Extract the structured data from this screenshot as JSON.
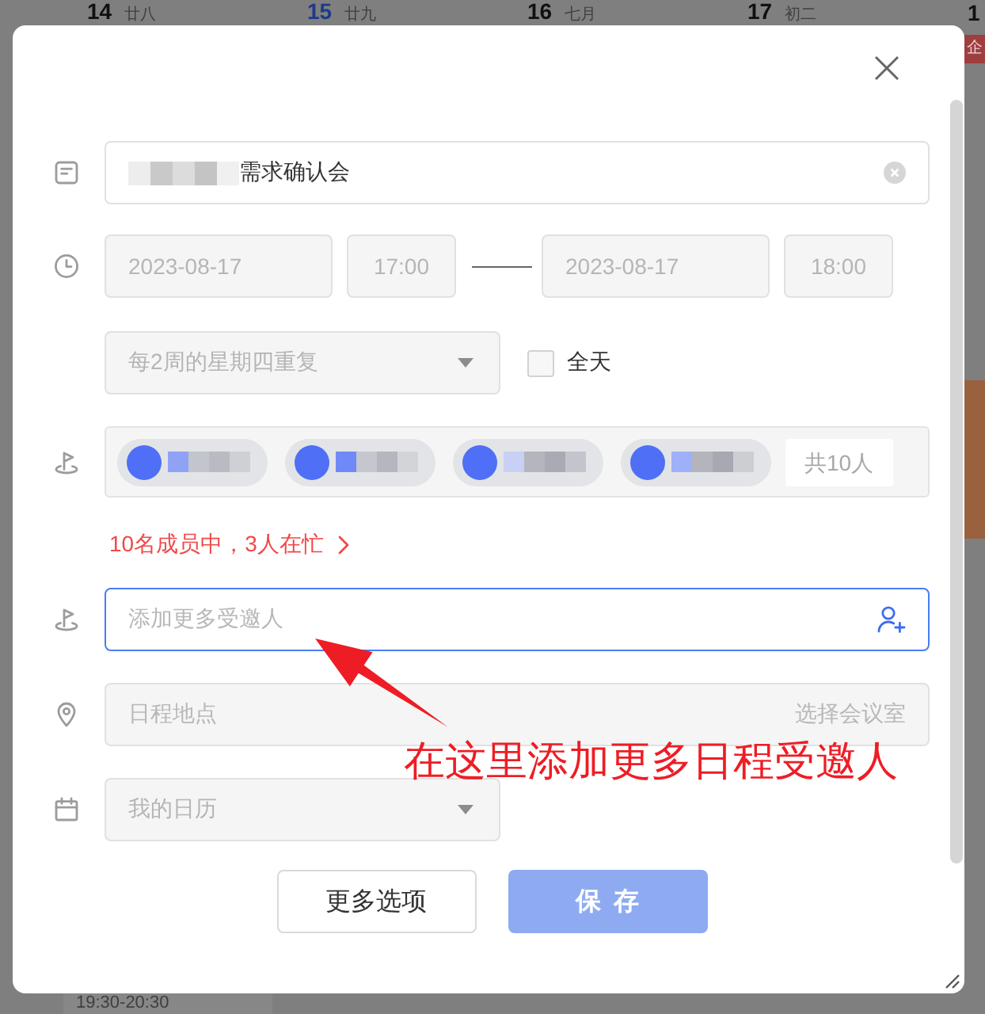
{
  "calendar": {
    "days": [
      {
        "date": "14",
        "lunar": "廿八",
        "today": false
      },
      {
        "date": "15",
        "lunar": "廿九",
        "today": true
      },
      {
        "date": "16",
        "lunar": "七月",
        "today": false
      },
      {
        "date": "17",
        "lunar": "初二",
        "today": false
      },
      {
        "date": "1",
        "today": false
      }
    ],
    "tag": "企",
    "event_time": "19:30-20:30"
  },
  "dialog": {
    "title_field": {
      "value": "需求确认会",
      "redacted_prefix": true
    },
    "time": {
      "disabled": true,
      "start_date": "2023-08-17",
      "start_time": "17:00",
      "end_date": "2023-08-17",
      "end_time": "18:00"
    },
    "repeat_select": {
      "value": "每2周的星期四重复",
      "disabled": true
    },
    "all_day": {
      "label": "全天",
      "checked": false
    },
    "attendees": {
      "chips": [
        {
          "redacted": true
        },
        {
          "redacted": true
        },
        {
          "redacted": true
        },
        {
          "redacted": true
        }
      ],
      "count": "共10人"
    },
    "busy_notice": "10名成员中，3人在忙",
    "invite_field": {
      "placeholder": "添加更多受邀人",
      "focused": true
    },
    "location_field": {
      "placeholder": "日程地点",
      "action": "选择会议室",
      "disabled": true
    },
    "calendar_select": {
      "value": "我的日历",
      "disabled": true
    },
    "buttons": [
      {
        "label": "更多选项",
        "kind": "secondary",
        "disabled": false
      },
      {
        "label": "保存",
        "kind": "primary",
        "disabled": true
      }
    ]
  },
  "annotation": {
    "text": "在这里添加更多日程受邀人"
  }
}
